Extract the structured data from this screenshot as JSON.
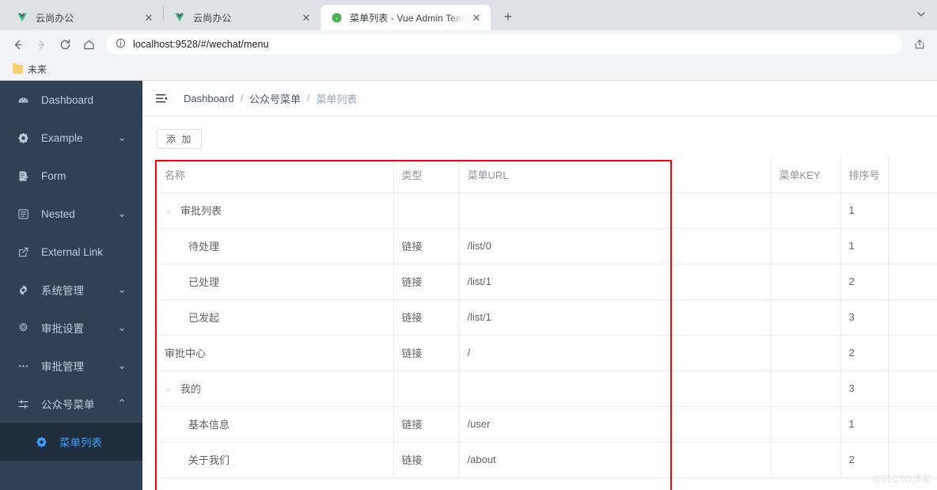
{
  "browser": {
    "tabs": [
      {
        "title": "云尚办公",
        "favicon": "vue-logo-icon",
        "active": false
      },
      {
        "title": "云尚办公",
        "favicon": "vue-logo-icon",
        "active": false
      },
      {
        "title": "菜单列表 - Vue Admin Templat",
        "favicon": "vue-admin-icon",
        "active": true
      }
    ],
    "new_tab_label": "+",
    "tab_close_label": "✕",
    "tab_list_icon": "chevron-down-icon",
    "toolbar": {
      "back_icon": "arrow-left-icon",
      "forward_icon": "arrow-right-icon",
      "reload_icon": "reload-icon",
      "home_icon": "home-icon",
      "info_icon": "page-info-icon",
      "share_icon": "share-icon",
      "url_host": "localhost:9528",
      "url_path": "/#/wechat/menu",
      "url_full": "localhost:9528/#/wechat/menu"
    },
    "bookmarks": [
      {
        "label": "未来",
        "icon": "folder-icon"
      }
    ]
  },
  "sidebar": {
    "items": [
      {
        "label": "Dashboard",
        "icon": "dashboard-icon",
        "has_arrow": false,
        "arrow": ""
      },
      {
        "label": "Example",
        "icon": "component-icon",
        "has_arrow": true,
        "arrow": "⌄"
      },
      {
        "label": "Form",
        "icon": "form-icon",
        "has_arrow": false,
        "arrow": ""
      },
      {
        "label": "Nested",
        "icon": "nested-list-icon",
        "has_arrow": true,
        "arrow": "⌄"
      },
      {
        "label": "External Link",
        "icon": "external-link-icon",
        "has_arrow": false,
        "arrow": ""
      },
      {
        "label": "系统管理",
        "icon": "gear-icon",
        "has_arrow": true,
        "arrow": "⌄"
      },
      {
        "label": "审批设置",
        "icon": "settings-outline-icon",
        "has_arrow": true,
        "arrow": "⌄"
      },
      {
        "label": "审批管理",
        "icon": "ellipsis-icon",
        "has_arrow": true,
        "arrow": "⌄"
      },
      {
        "label": "公众号菜单",
        "icon": "sliders-icon",
        "has_arrow": true,
        "arrow": "⌃",
        "expanded": true
      }
    ],
    "submenu": [
      {
        "label": "菜单列表",
        "icon": "component-icon",
        "active": true
      }
    ]
  },
  "navbar": {
    "hamburger_icon": "hamburger-collapse-icon",
    "breadcrumb": [
      {
        "label": "Dashboard",
        "last": false
      },
      {
        "label": "公众号菜单",
        "last": false
      },
      {
        "label": "菜单列表",
        "last": true
      }
    ],
    "breadcrumb_separator": "/"
  },
  "main": {
    "add_button_label": "添 加",
    "table": {
      "columns": [
        "名称",
        "类型",
        "菜单URL",
        "",
        "菜单KEY",
        "排序号",
        ""
      ],
      "rows": [
        {
          "name": "审批列表",
          "level": 0,
          "expandable": true,
          "arrow": "⌄",
          "type": "",
          "url": "",
          "key": "",
          "sort": "1"
        },
        {
          "name": "待处理",
          "level": 1,
          "expandable": false,
          "arrow": "",
          "type": "链接",
          "url": "/list/0",
          "key": "",
          "sort": "1"
        },
        {
          "name": "已处理",
          "level": 1,
          "expandable": false,
          "arrow": "",
          "type": "链接",
          "url": "/list/1",
          "key": "",
          "sort": "2"
        },
        {
          "name": "已发起",
          "level": 1,
          "expandable": false,
          "arrow": "",
          "type": "链接",
          "url": "/list/1",
          "key": "",
          "sort": "3"
        },
        {
          "name": "审批中心",
          "level": 0,
          "expandable": false,
          "arrow": "",
          "type": "链接",
          "url": "/",
          "key": "",
          "sort": "2"
        },
        {
          "name": "我的",
          "level": 0,
          "expandable": true,
          "arrow": "⌄",
          "type": "",
          "url": "",
          "key": "",
          "sort": "3"
        },
        {
          "name": "基本信息",
          "level": 1,
          "expandable": false,
          "arrow": "",
          "type": "链接",
          "url": "/user",
          "key": "",
          "sort": "1"
        },
        {
          "name": "关于我们",
          "level": 1,
          "expandable": false,
          "arrow": "",
          "type": "链接",
          "url": "/about",
          "key": "",
          "sort": "2"
        }
      ]
    }
  },
  "watermark": "@51CTO博客",
  "colors": {
    "sidebar_bg": "#304156",
    "submenu_bg": "#1f2d3d",
    "accent_blue": "#409EFF",
    "annotation_red": "#FB0007",
    "tabstrip_bg": "#DEE1E6",
    "toolbar_bg": "#F1F3F4"
  }
}
